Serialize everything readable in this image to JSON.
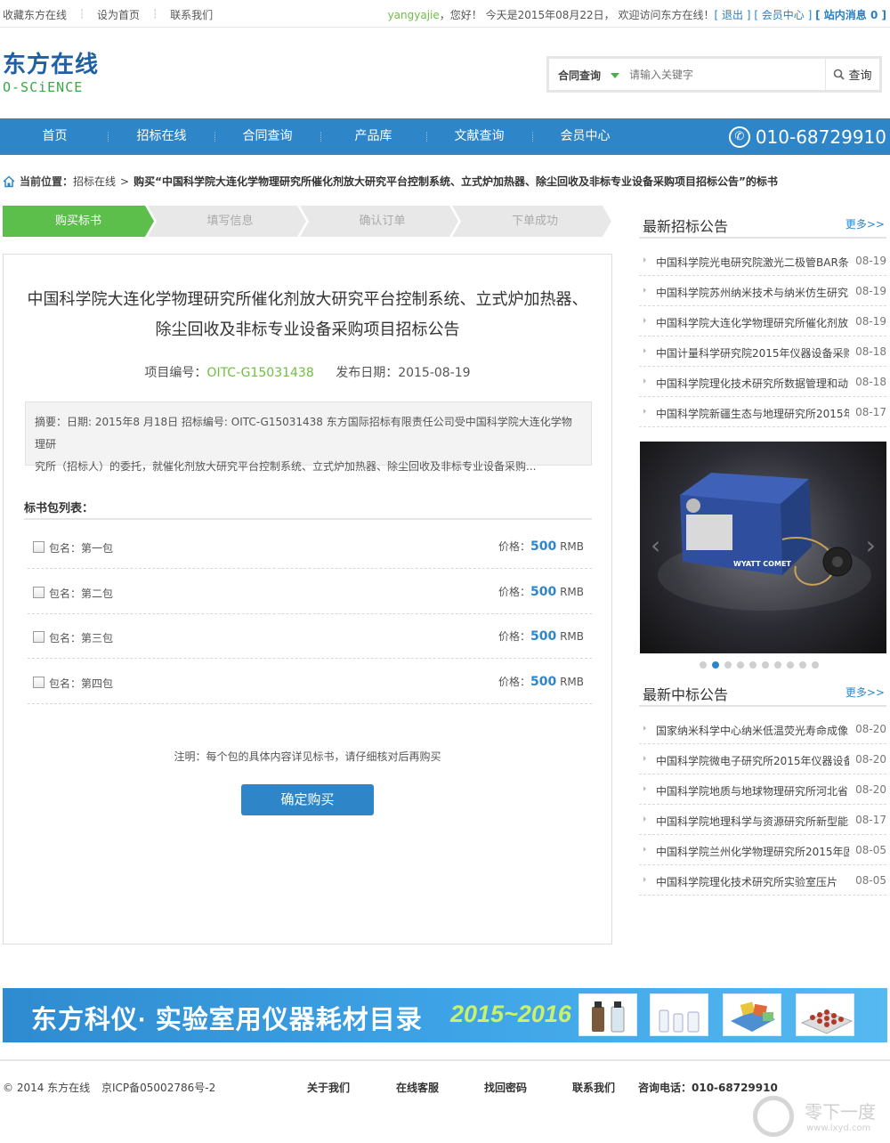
{
  "topbar": {
    "links": [
      "收藏东方在线",
      "设为首页",
      "联系我们"
    ],
    "username": "yangyajie",
    "greeting": "，您好！ 今天是2015年08月22日， 欢迎访问东方在线！",
    "logout": "[ 退出 ]",
    "member": "[ 会员中心 ]",
    "messages": "[ 站内消息 0 ]"
  },
  "logo": {
    "cn": "东方在线",
    "en": "O-SCiENCE"
  },
  "search": {
    "type": "合同查询",
    "placeholder": "请输入关键字",
    "button": "查询"
  },
  "nav": {
    "items": [
      "首页",
      "招标在线",
      "合同查询",
      "产品库",
      "文献查询",
      "会员中心"
    ],
    "phone": "010-68729910"
  },
  "breadcrumb": {
    "label": "当前位置：",
    "section": "招标在线",
    "sep": ">",
    "current": "购买“中国科学院大连化学物理研究所催化剂放大研究平台控制系统、立式炉加热器、除尘回收及非标专业设备采购项目招标公告”的标书"
  },
  "steps": [
    "购买标书",
    "填写信息",
    "确认订单",
    "下单成功"
  ],
  "colors": {
    "accent": "#2e86c9",
    "step_active": "#5cbf4c",
    "step_inactive": "#e8e8e8",
    "code": "#6fbe44"
  },
  "notice": {
    "title_line1": "中国科学院大连化学物理研究所催化剂放大研究平台控制系统、立式炉加热器、",
    "title_line2": "除尘回收及非标专业设备采购项目招标公告",
    "code_label": "项目编号：",
    "code": "OITC-G15031438",
    "date_label": "发布日期：",
    "date": "2015-08-19",
    "summary_line1": "摘要：日期: 2015年8 月18日 招标编号: OITC-G15031438 东方国际招标有限责任公司受中国科学院大连化学物理研",
    "summary_line2": "究所（招标人）的委托，就催化剂放大研究平台控制系统、立式炉加热器、除尘回收及非标专业设备采购..."
  },
  "packages": {
    "heading": "标书包列表：",
    "price_label": "价格：",
    "currency": "RMB",
    "items": [
      {
        "name": "包名：第一包",
        "price": "500"
      },
      {
        "name": "包名：第二包",
        "price": "500"
      },
      {
        "name": "包名：第三包",
        "price": "500"
      },
      {
        "name": "包名：第四包",
        "price": "500"
      }
    ],
    "note": "注明：每个包的具体内容详见标书，请仔细核对后再购买",
    "buy_button": "确定购买"
  },
  "sidebar": {
    "latest_tenders": {
      "title": "最新招标公告",
      "more": "更多>>",
      "items": [
        {
          "text": "中国科学院光电研究院激光二极管BAR条",
          "date": "08-19"
        },
        {
          "text": "中国科学院苏州纳米技术与纳米仿生研究",
          "date": "08-19"
        },
        {
          "text": "中国科学院大连化学物理研究所催化剂放",
          "date": "08-19"
        },
        {
          "text": "中国计量科学研究院2015年仪器设备采购",
          "date": "08-18"
        },
        {
          "text": "中国科学院理化技术研究所数据管理和动",
          "date": "08-18"
        },
        {
          "text": "中国科学院新疆生态与地理研究所2015年",
          "date": "08-17"
        }
      ]
    },
    "slider": {
      "device_label": "WYATT COMET",
      "dot_count": 10,
      "active_dot": 2
    },
    "latest_awards": {
      "title": "最新中标公告",
      "more": "更多>>",
      "items": [
        {
          "text": "国家纳米科学中心纳米低温荧光寿命成像",
          "date": "08-20"
        },
        {
          "text": "中国科学院微电子研究所2015年仪器设备",
          "date": "08-20"
        },
        {
          "text": "中国科学院地质与地球物理研究所河北省",
          "date": "08-20"
        },
        {
          "text": "中国科学院地理科学与资源研究所新型能",
          "date": "08-17"
        },
        {
          "text": "中国科学院兰州化学物理研究所2015年固",
          "date": "08-05"
        },
        {
          "text": "中国科学院理化技术研究所实验室压片",
          "date": "08-05"
        }
      ]
    }
  },
  "banner": {
    "brand": "东方科仪·",
    "title": "实验室用仪器耗材目录",
    "years": "2015~2016"
  },
  "footer": {
    "copyright": "© 2014 东方在线",
    "icp": "京ICP备05002786号-2",
    "links": [
      "关于我们",
      "在线客服",
      "找回密码",
      "联系我们"
    ],
    "hotline": "咨询电话：010-68729910"
  },
  "watermark": {
    "title": "零下一度",
    "url": "www.lxyd.com"
  }
}
